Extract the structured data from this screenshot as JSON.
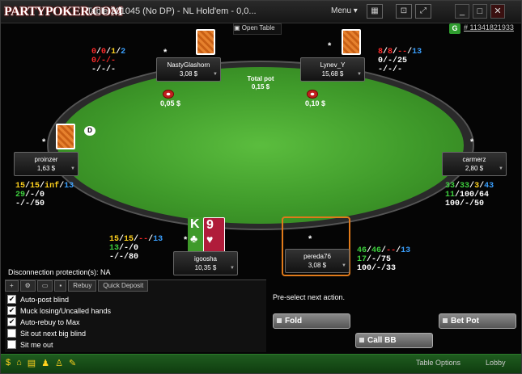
{
  "titlebar": {
    "logo": "PARTYPOKER.COM",
    "title": "Table  201045 (No DP) -  NL  Hold'em - 0,0...",
    "menu": "Menu",
    "minimize": "_",
    "restore": "□",
    "close": "✕"
  },
  "hand_id": "# 11341821933",
  "open_table": "Open Table",
  "pot": {
    "label": "Total pot",
    "value": "0,15 $"
  },
  "seats": [
    {
      "name": "NastyGlashorn",
      "stack": "3,08 $",
      "bet": "0,05 $",
      "stats": [
        [
          "0",
          "r"
        ],
        [
          "/",
          "w"
        ],
        [
          "0",
          "r"
        ],
        [
          "/",
          "w"
        ],
        [
          "1",
          "y"
        ],
        [
          "/",
          "w"
        ],
        [
          "2",
          "b"
        ]
      ],
      "stats2": "0/-/-",
      "stats3": "-/-/-"
    },
    {
      "name": "Lynev_Y",
      "stack": "15,68 $",
      "bet": "0,10 $",
      "stats": "8/8/--/13",
      "stats2": "0/-/25",
      "stats3": "-/-/-"
    },
    {
      "name": "proinzer",
      "stack": "1,63 $",
      "stats": "15/15/inf/13",
      "stats2": "29/-/0",
      "stats3": "-/-/50"
    },
    {
      "name": "carmerz",
      "stack": "2,80 $",
      "stats": "33/33/3/43",
      "stats2": "11/100/64",
      "stats3": "100/-/50"
    },
    {
      "name": "igoosha",
      "stack": "10,35 $",
      "stats": "15/15/--/13",
      "stats2": "13/-/0",
      "stats3": "-/-/80"
    },
    {
      "name": "pereda76",
      "stack": "3,08 $",
      "stats": "46/46/--/13",
      "stats2": "17/-/75",
      "stats3": "100/-/33"
    }
  ],
  "hero_cards": [
    {
      "rank": "K",
      "suit": "♣"
    },
    {
      "rank": "9",
      "suit": "♥"
    }
  ],
  "disconnection": "Disconnection protection(s): NA",
  "panel_tabs": [
    "Rebuy",
    "Quick Deposit"
  ],
  "options": [
    {
      "label": "Auto-post blind",
      "checked": true
    },
    {
      "label": "Muck losing/Uncalled hands",
      "checked": true
    },
    {
      "label": "Auto-rebuy to Max",
      "checked": true
    },
    {
      "label": "Sit out next big blind",
      "checked": false
    },
    {
      "label": "Sit me out",
      "checked": false
    }
  ],
  "preselect": "Pre-select next action.",
  "actions": {
    "fold": "Fold",
    "call": "Call BB",
    "bet": "Bet Pot"
  },
  "statusbar": {
    "table_options": "Table Options",
    "lobby": "Lobby"
  },
  "colors": {
    "felt": "#3f9a2a",
    "accent_orange": "#e07a1a",
    "status_green": "#1f5c1f"
  }
}
